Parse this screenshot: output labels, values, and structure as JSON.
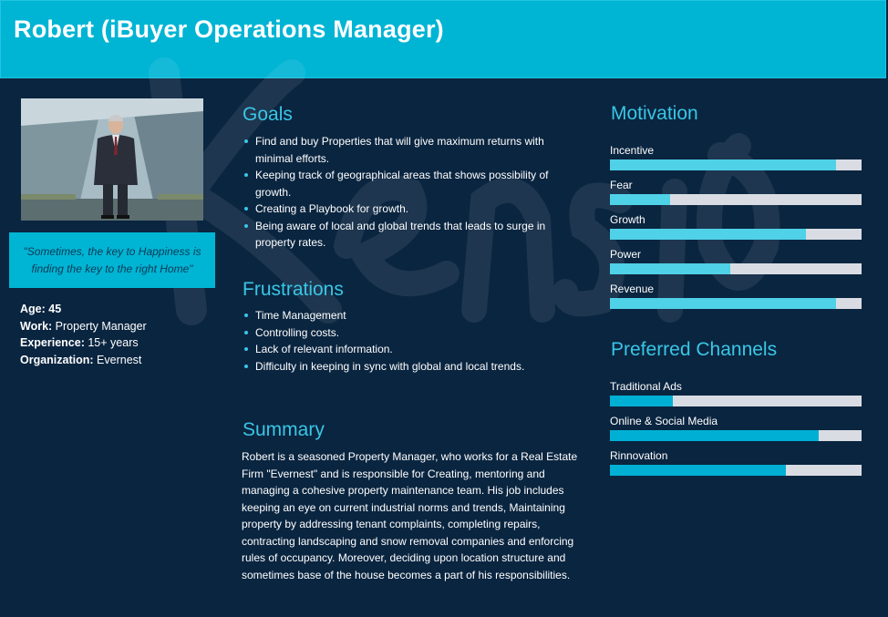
{
  "header": {
    "title": "Robert (iBuyer Operations Manager)"
  },
  "profile": {
    "quote": "\"Sometimes, the key to Happiness is finding the key to the right Home\"",
    "age_label": "Age: 45",
    "work_label": "Work:",
    "work_value": "Property Manager",
    "experience_label": "Experience:",
    "experience_value": "15+ years",
    "organization_label": "Organization:",
    "organization_value": "Evernest"
  },
  "goals": {
    "title": "Goals",
    "items": [
      "Find and buy Properties that will give maximum returns with minimal efforts.",
      "Keeping track of geographical areas that shows possibility of growth.",
      "Creating a Playbook for growth.",
      "Being aware of local and global trends that leads to surge in property rates."
    ]
  },
  "frustrations": {
    "title": "Frustrations",
    "items": [
      "Time Management",
      "Controlling costs.",
      "Lack of relevant information.",
      "Difficulty in keeping in sync with global and local trends."
    ]
  },
  "summary": {
    "title": "Summary",
    "text": "Robert is a seasoned Property Manager, who works for a Real Estate Firm \"Evernest\"  and is responsible for Creating, mentoring and managing a cohesive property maintenance team. His job includes keeping an eye on current industrial norms and trends, Maintaining property by addressing tenant complaints, completing repairs, contracting landscaping and snow removal companies and enforcing rules of occupancy. Moreover, deciding upon location structure and sometimes base of the house becomes a part of his responsibilities."
  },
  "motivation": {
    "title": "Motivation",
    "fill_color": "#4fd1e8",
    "items": [
      {
        "label": "Incentive",
        "value": 0.9
      },
      {
        "label": "Fear",
        "value": 0.24
      },
      {
        "label": "Growth",
        "value": 0.78
      },
      {
        "label": "Power",
        "value": 0.48
      },
      {
        "label": "Revenue",
        "value": 0.9
      }
    ]
  },
  "channels": {
    "title": "Preferred Channels",
    "fill_color": "#00b0d4",
    "items": [
      {
        "label": "Traditional Ads",
        "value": 0.25
      },
      {
        "label": "Online & Social Media",
        "value": 0.83
      },
      {
        "label": "Rinnovation",
        "value": 0.7
      }
    ]
  },
  "colors": {
    "background": "#0a2540",
    "accent": "#00b4d4",
    "heading": "#39c6e6",
    "track": "#d9dde3"
  }
}
